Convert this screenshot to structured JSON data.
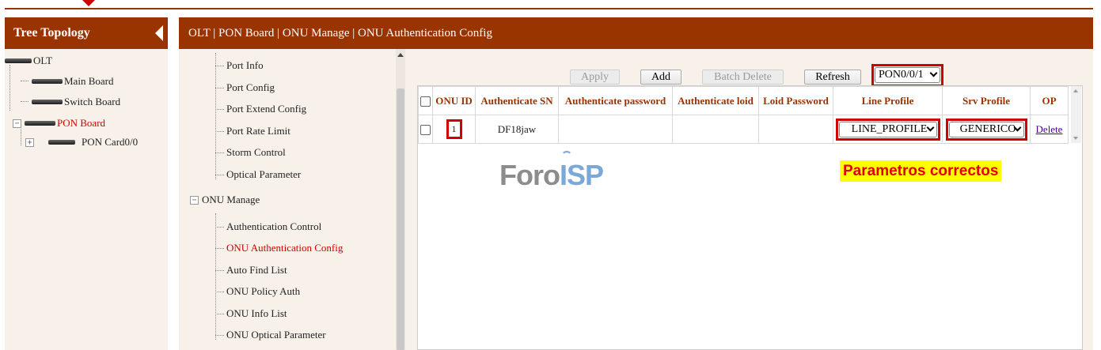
{
  "tree": {
    "title": "Tree Topology",
    "nodes": {
      "olt": "OLT",
      "main_board": "Main Board",
      "switch_board": "Switch Board",
      "pon_board": "PON Board",
      "pon_card": "PON Card0/0"
    }
  },
  "breadcrumb": "OLT | PON Board | ONU Manage | ONU Authentication Config",
  "menu": {
    "port_items": [
      "Port Info",
      "Port Config",
      "Port Extend Config",
      "Port Rate Limit",
      "Storm Control",
      "Optical Parameter"
    ],
    "onu_group": "ONU Manage",
    "onu_items": [
      "Authentication Control",
      "ONU Authentication Config",
      "Auto Find List",
      "ONU Policy Auth",
      "ONU Info List",
      "ONU Optical Parameter"
    ],
    "selected": "ONU Authentication Config"
  },
  "toolbar": {
    "apply": "Apply",
    "add": "Add",
    "batch_delete": "Batch Delete",
    "refresh": "Refresh",
    "pon_select": "PON0/0/1"
  },
  "table": {
    "headers": [
      "ONU ID",
      "Authenticate SN",
      "Authenticate password",
      "Authenticate loid",
      "Loid Password",
      "Line Profile",
      "Srv Profile",
      "OP"
    ],
    "rows": [
      {
        "onu_id": "1",
        "sn": "DF18jaw",
        "password": "",
        "loid": "",
        "loid_password": "",
        "line_profile": "LINE_PROFILE",
        "srv_profile": "GENERICO",
        "op": "Delete"
      }
    ]
  },
  "watermark": {
    "part1": "Foro",
    "part2": "ISP"
  },
  "annotation": "Parametros correctos",
  "colors": {
    "brand": "#993300",
    "highlight_box": "#d00000",
    "note_bg": "#ffff00",
    "note_text": "#e00000"
  }
}
